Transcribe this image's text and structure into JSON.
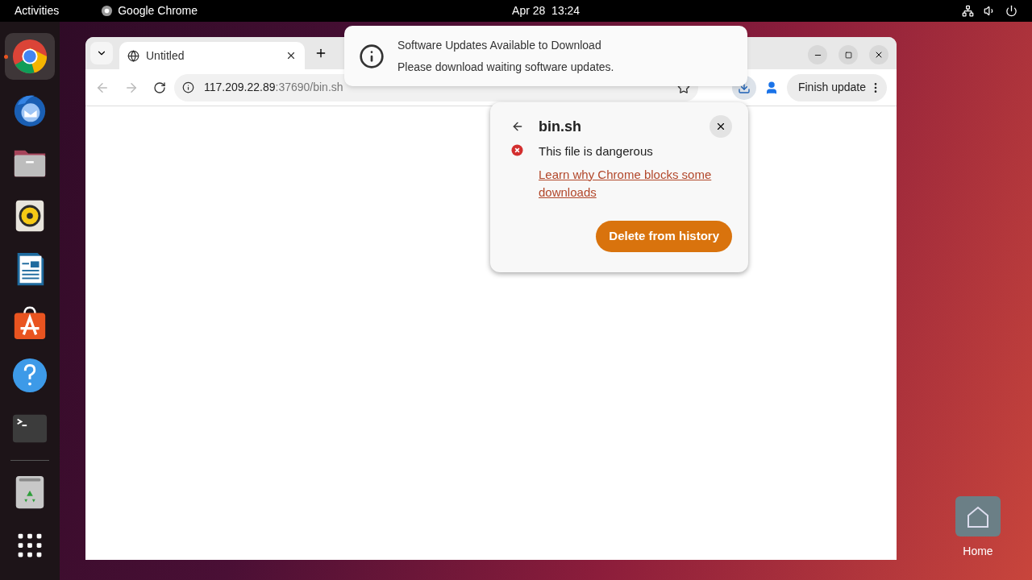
{
  "top_bar": {
    "activities": "Activities",
    "app_name": "Google Chrome",
    "clock": "Apr 28  13:24"
  },
  "dock": {
    "items": [
      {
        "kind": "chrome",
        "selected": true,
        "running": true
      },
      {
        "kind": "mail",
        "selected": false,
        "running": false
      },
      {
        "kind": "files",
        "selected": false,
        "running": false
      },
      {
        "kind": "music",
        "selected": false,
        "running": false
      },
      {
        "kind": "writer",
        "selected": false,
        "running": false
      },
      {
        "kind": "store",
        "selected": false,
        "running": false
      },
      {
        "kind": "help",
        "selected": false,
        "running": false
      },
      {
        "kind": "terminal",
        "selected": false,
        "running": false
      },
      {
        "kind": "trash",
        "selected": false,
        "running": false
      },
      {
        "kind": "apps",
        "selected": false,
        "running": false
      }
    ]
  },
  "desktop_icons": [
    {
      "label": "Home"
    }
  ],
  "browser": {
    "tabs": [
      {
        "title": "Untitled",
        "selected": true
      }
    ],
    "address": {
      "host": "117.209.22.89",
      "path": ":37690/bin.sh"
    },
    "profile_button": "Finish update"
  },
  "notification": {
    "title": "Software Updates Available to Download",
    "body": "Please download waiting software updates."
  },
  "download_popup": {
    "file_name": "bin.sh",
    "warning": "This file is dangerous",
    "link": "Learn why Chrome blocks some downloads",
    "button": "Delete from history"
  }
}
